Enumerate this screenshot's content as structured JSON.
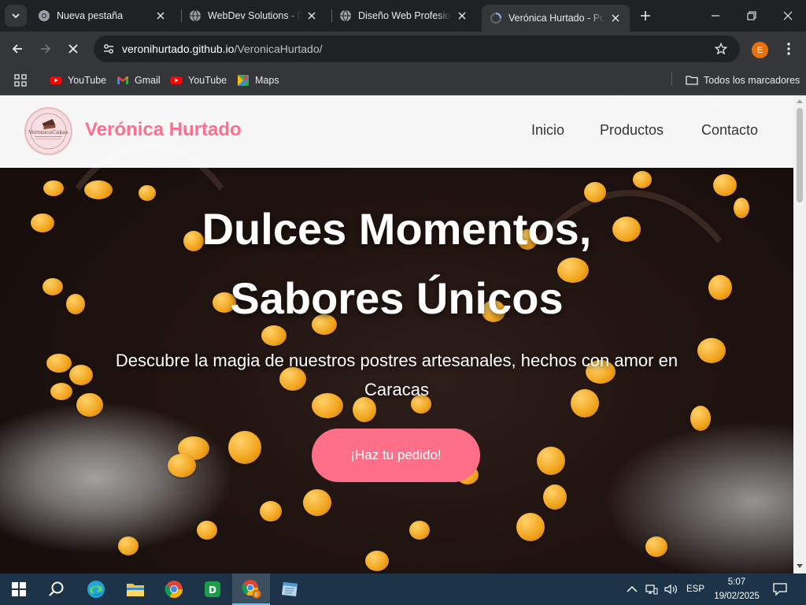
{
  "browser": {
    "tabs": [
      {
        "title": "Nueva pestaña",
        "active": false
      },
      {
        "title": "WebDev Solutions - Di",
        "active": false
      },
      {
        "title": "Diseño Web Profesiona",
        "active": false
      },
      {
        "title": "Verónica Hurtado - Pos",
        "active": true
      }
    ],
    "url_host": "veronihurtado.github.io",
    "url_path": "/VeronicaHurtado/",
    "profile_initial": "E",
    "bookmarks": [
      {
        "label": "YouTube",
        "icon": "youtube-icon"
      },
      {
        "label": "Gmail",
        "icon": "gmail-icon"
      },
      {
        "label": "YouTube",
        "icon": "youtube-icon"
      },
      {
        "label": "Maps",
        "icon": "maps-icon"
      }
    ],
    "all_bookmarks": "Todos los marcadores"
  },
  "site": {
    "logo_text": "VeronicaCakes",
    "brand": "Verónica Hurtado",
    "nav": [
      "Inicio",
      "Productos",
      "Contacto"
    ],
    "hero_title_line1": "Dulces Momentos,",
    "hero_title_line2": "Sabores Únicos",
    "hero_subtitle": "Descubre la magia de nuestros postres artesanales, hechos con amor en Caracas",
    "cta": "¡Haz tu pedido!",
    "colors": {
      "brand": "#ff6f8d",
      "cta": "#ff6f87",
      "nav_text": "#333333"
    }
  },
  "taskbar": {
    "apps": [
      "windows-start",
      "search",
      "edge",
      "file-explorer",
      "chrome",
      "d-app",
      "chrome-profile",
      "notes-app"
    ],
    "language": "ESP",
    "time": "5:07",
    "date": "19/02/2025"
  }
}
